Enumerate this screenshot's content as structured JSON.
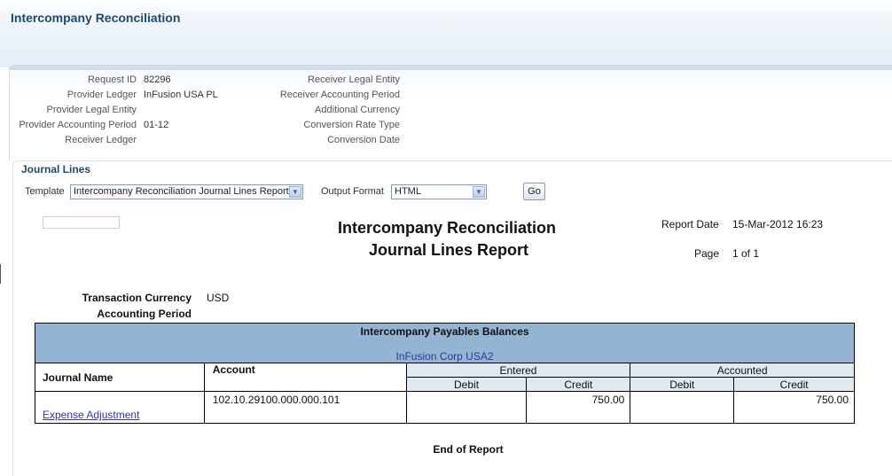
{
  "page": {
    "title": "Intercompany Reconciliation"
  },
  "request": {
    "left": [
      {
        "label": "Request ID",
        "value": "82296"
      },
      {
        "label": "Provider Ledger",
        "value": "InFusion USA PL"
      },
      {
        "label": "Provider Legal Entity",
        "value": ""
      },
      {
        "label": "Provider Accounting Period",
        "value": "01-12"
      },
      {
        "label": "Receiver Ledger",
        "value": ""
      }
    ],
    "right": [
      {
        "label": "Receiver Legal Entity",
        "value": ""
      },
      {
        "label": "Receiver Accounting Period",
        "value": ""
      },
      {
        "label": "Additional Currency",
        "value": ""
      },
      {
        "label": "Conversion Rate Type",
        "value": ""
      },
      {
        "label": "Conversion Date",
        "value": ""
      }
    ]
  },
  "journal_lines": {
    "title": "Journal Lines",
    "template_label": "Template",
    "template_value": "Intercompany Reconciliation Journal Lines Report",
    "output_label": "Output Format",
    "output_value": "HTML",
    "go_label": "Go"
  },
  "report": {
    "title_line1": "Intercompany Reconciliation",
    "title_line2": "Journal Lines Report",
    "report_date_label": "Report Date",
    "report_date_value": "15-Mar-2012 16:23",
    "page_label": "Page",
    "page_value": "1 of 1",
    "currency_label": "Transaction Currency",
    "currency_value": "USD",
    "period_label": "Accounting Period",
    "section_title": "Intercompany Payables Balances",
    "section_entity": "InFusion Corp USA2",
    "columns": {
      "journal_name": "Journal Name",
      "account": "Account",
      "entered": "Entered",
      "accounted": "Accounted",
      "debit": "Debit",
      "credit": "Credit"
    },
    "rows": [
      {
        "journal_name": "Expense Adjustment",
        "account": "102.10.29100.000.000.101",
        "entered_debit": "",
        "entered_credit": "750.00",
        "accounted_debit": "",
        "accounted_credit": "750.00"
      }
    ],
    "end_text": "End of Report"
  }
}
